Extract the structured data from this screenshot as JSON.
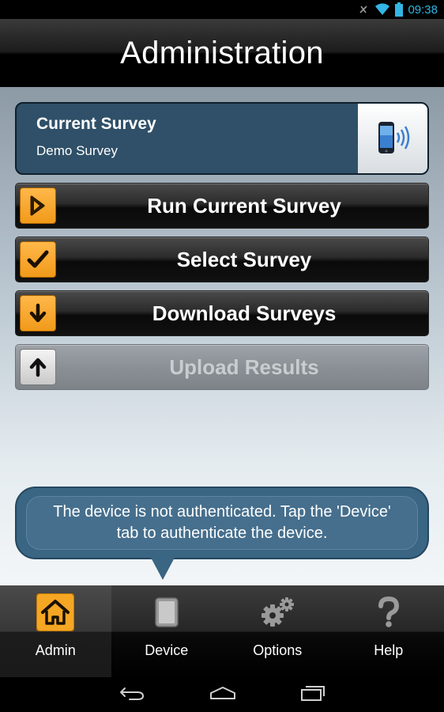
{
  "status_bar": {
    "time": "09:38"
  },
  "header": {
    "title": "Administration"
  },
  "current_survey": {
    "heading": "Current Survey",
    "name": "Demo Survey"
  },
  "actions": [
    {
      "label": "Run Current Survey",
      "icon": "play-icon",
      "enabled": true
    },
    {
      "label": "Select Survey",
      "icon": "checkmark-icon",
      "enabled": true
    },
    {
      "label": "Download Surveys",
      "icon": "arrow-down-icon",
      "enabled": true
    },
    {
      "label": "Upload Results",
      "icon": "arrow-up-icon",
      "enabled": false
    }
  ],
  "notice": {
    "text": "The device is not authenticated. Tap the 'Device' tab to authenticate the device."
  },
  "tabs": [
    {
      "label": "Admin",
      "icon": "home-icon",
      "active": true
    },
    {
      "label": "Device",
      "icon": "tablet-icon",
      "active": false
    },
    {
      "label": "Options",
      "icon": "gears-icon",
      "active": false
    },
    {
      "label": "Help",
      "icon": "question-icon",
      "active": false
    }
  ],
  "colors": {
    "accent_orange": "#f5a623",
    "survey_panel": "#2f5068",
    "status_blue": "#33b5e5"
  }
}
